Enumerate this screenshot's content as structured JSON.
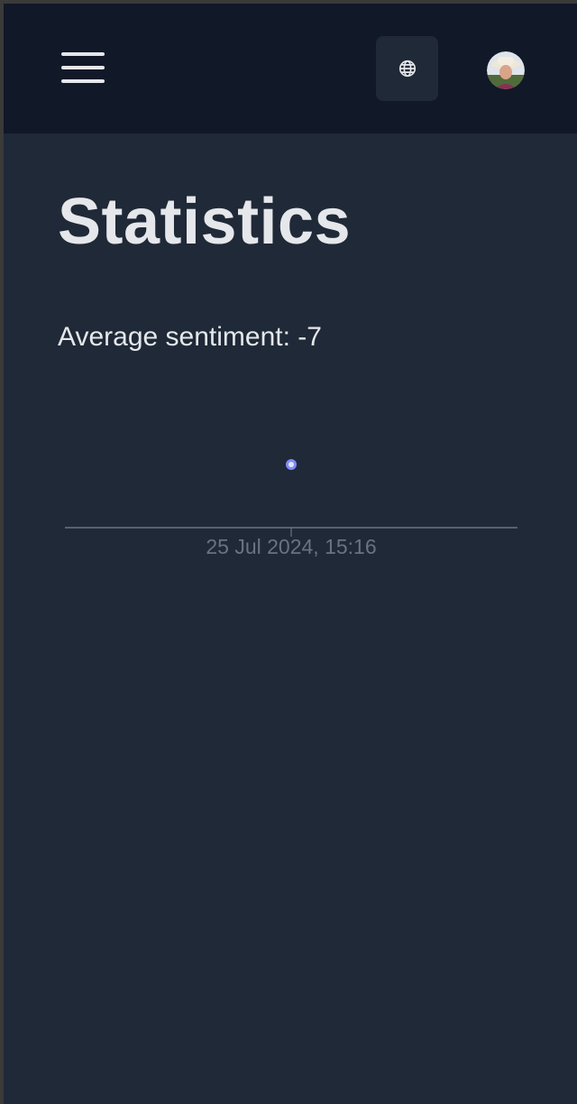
{
  "header": {
    "menu_icon": "hamburger-menu-icon",
    "language_icon": "globe-icon",
    "avatar_icon": "user-avatar"
  },
  "page": {
    "title": "Statistics",
    "average_label": "Average sentiment:",
    "average_value": "-7"
  },
  "colors": {
    "topbar": "#111827",
    "background": "#1f2937",
    "point": "#818cf8",
    "axis": "#6b7280",
    "tick_label": "#6b7280"
  },
  "chart_data": {
    "type": "scatter",
    "x": [
      "25 Jul 2024, 15:16"
    ],
    "y": [
      -7
    ],
    "x_tick_labels": [
      "25 Jul 2024, 15:16"
    ],
    "grid": false
  }
}
